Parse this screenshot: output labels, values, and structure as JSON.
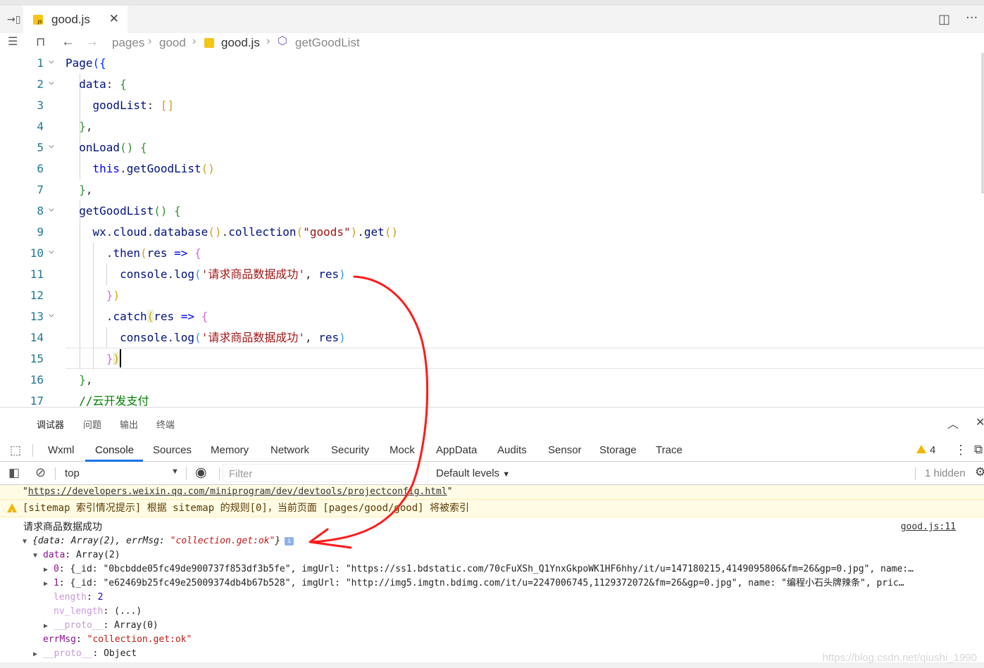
{
  "tab": {
    "label": "good.js"
  },
  "breadcrumb": {
    "items": [
      "pages",
      "good",
      "good.js",
      "getGoodList"
    ]
  },
  "code": {
    "line_numbers": [
      "1",
      "2",
      "3",
      "4",
      "5",
      "6",
      "7",
      "8",
      "9",
      "10",
      "11",
      "12",
      "13",
      "14",
      "15",
      "16",
      "17"
    ],
    "lines": [
      "Page({",
      "  data: {",
      "    goodList: []",
      "  },",
      "  onLoad() {",
      "    this.getGoodList()",
      "  },",
      "  getGoodList() {",
      "    wx.cloud.database().collection(\"goods\").get()",
      "      .then(res => {",
      "        console.log('请求商品数据成功', res)",
      "      })",
      "      .catch(res => {",
      "        console.log('请求商品数据成功', res)",
      "      })",
      "  },",
      "  //云开发支付"
    ]
  },
  "devtools": {
    "top_tabs": [
      "调试器",
      "问题",
      "输出",
      "终端"
    ],
    "panel_tabs": [
      "Wxml",
      "Console",
      "Sources",
      "Memory",
      "Network",
      "Security",
      "Mock",
      "AppData",
      "Audits",
      "Sensor",
      "Storage",
      "Trace"
    ],
    "active_tab": "Console",
    "warning_count": "4",
    "context": "top",
    "filter_placeholder": "Filter",
    "levels": "Default levels",
    "hidden": "1 hidden"
  },
  "console": {
    "link_line": "https://developers.weixin.qq.com/miniprogram/dev/devtools/projectconfig.html",
    "warning_line": "[sitemap 索引情况提示] 根据 sitemap 的规则[0]，当前页面 [pages/good/good] 将被索引",
    "log_message": "请求商品数据成功",
    "log_source": "good.js:11",
    "obj_summary_prefix": "{data: Array(2), errMsg: ",
    "obj_summary_errmsg": "\"collection.get:ok\"",
    "obj_summary_suffix": "}",
    "data_key": "data",
    "data_val": "Array(2)",
    "item0_key": "0",
    "item0_val": "{_id: \"0bcbdde05fc49de900737f853df3b5fe\", imgUrl: \"https://ss1.bdstatic.com/70cFuXSh_Q1YnxGkpoWK1HF6hhy/it/u=147180215,4149095806&fm=26&gp=0.jpg\", name:…",
    "item1_key": "1",
    "item1_val": "{_id: \"e62469b25fc49e25009374db4b67b528\", imgUrl: \"http://img5.imgtn.bdimg.com/it/u=2247006745,1129372072&fm=26&gp=0.jpg\", name: \"编程小石头牌辣条\", pric…",
    "length_key": "length",
    "length_val": "2",
    "nvlength_key": "nv_length",
    "nvlength_val": "(...)",
    "proto1_key": "__proto__",
    "proto1_val": "Array(0)",
    "errmsg_key": "errMsg",
    "errmsg_val": "\"collection.get:ok\"",
    "proto2_key": "__proto__",
    "proto2_val": "Object"
  },
  "watermark": "https://blog.csdn.net/qiushi_1990",
  "colors": {
    "accent": "#1a73e8",
    "annotation": "#ff1a1a",
    "warning_bg": "#fffbe5"
  },
  "icons": [
    "split-editor-icon",
    "more-icon",
    "bookmark-icon",
    "back-icon",
    "forward-icon",
    "outline-icon",
    "cube-icon",
    "close-icon",
    "inspect-icon",
    "sidebar-icon",
    "clear-icon",
    "eye-icon",
    "gear-icon",
    "chevron-up-icon",
    "warning-icon",
    "info-icon"
  ]
}
